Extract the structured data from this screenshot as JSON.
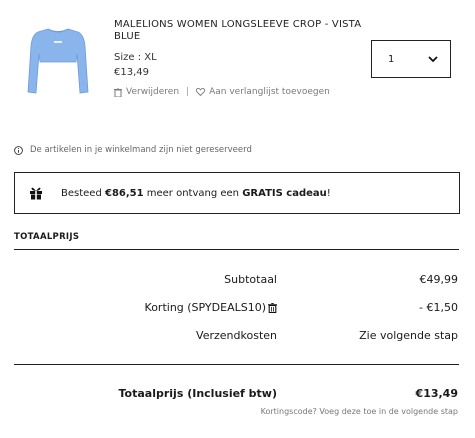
{
  "product": {
    "title": "MALELIONS WOMEN LONGSLEEVE CROP - VISTA BLUE",
    "size": "Size : XL",
    "price": "€13,49",
    "remove_label": "Verwijderen",
    "separator": "|",
    "wishlist_label": "Aan verlanglijst toevoegen",
    "quantity": "1",
    "image_color": "#8ab4ec"
  },
  "notice": "De artikelen in je winkelmand zijn niet gereserveerd",
  "gift_banner": {
    "pre": "Besteed ",
    "amount": "€86,51",
    "mid": " meer ontvang een ",
    "highlight": "GRATIS cadeau",
    "post": "!"
  },
  "totals": {
    "heading": "TOTAALPRIJS",
    "subtotal_label": "Subtotaal",
    "subtotal_value": "€49,99",
    "discount_label": "Korting (SPYDEALS10)",
    "discount_value": "- €1,50",
    "shipping_label": "Verzendkosten",
    "shipping_value": "Zie volgende stap",
    "total_label": "Totaalprijs (Inclusief btw)",
    "total_value": "€13,49",
    "promo_note": "Kortingscode? Voeg deze toe in de volgende stap"
  }
}
